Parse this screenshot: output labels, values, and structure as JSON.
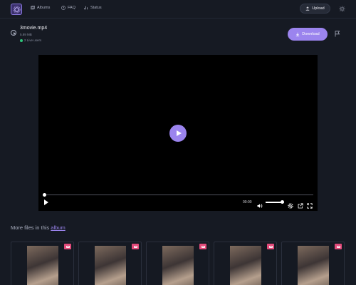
{
  "nav": {
    "links": [
      {
        "label": "Albums",
        "icon": "albums-icon"
      },
      {
        "label": "FAQ",
        "icon": "help-icon"
      },
      {
        "label": "Status",
        "icon": "chart-icon"
      }
    ],
    "upload_label": "Upload"
  },
  "file": {
    "name": "3movie.mp4",
    "size": "5.89 MB",
    "live_users": "2 Live users",
    "download_label": "Download"
  },
  "player": {
    "time": "00:00",
    "progress": 0,
    "volume": 0.9
  },
  "more": {
    "prefix": "More files in this ",
    "link": "album"
  },
  "thumbnails": [
    {
      "badge": "video-badge-icon"
    },
    {
      "badge": "video-badge-icon"
    },
    {
      "badge": "video-badge-icon"
    },
    {
      "badge": "video-badge-icon"
    },
    {
      "badge": "video-badge-icon"
    }
  ],
  "colors": {
    "accent": "#9b84ee",
    "background": "#161a23",
    "live": "#2fc57a",
    "badge": "#e24a7a"
  }
}
